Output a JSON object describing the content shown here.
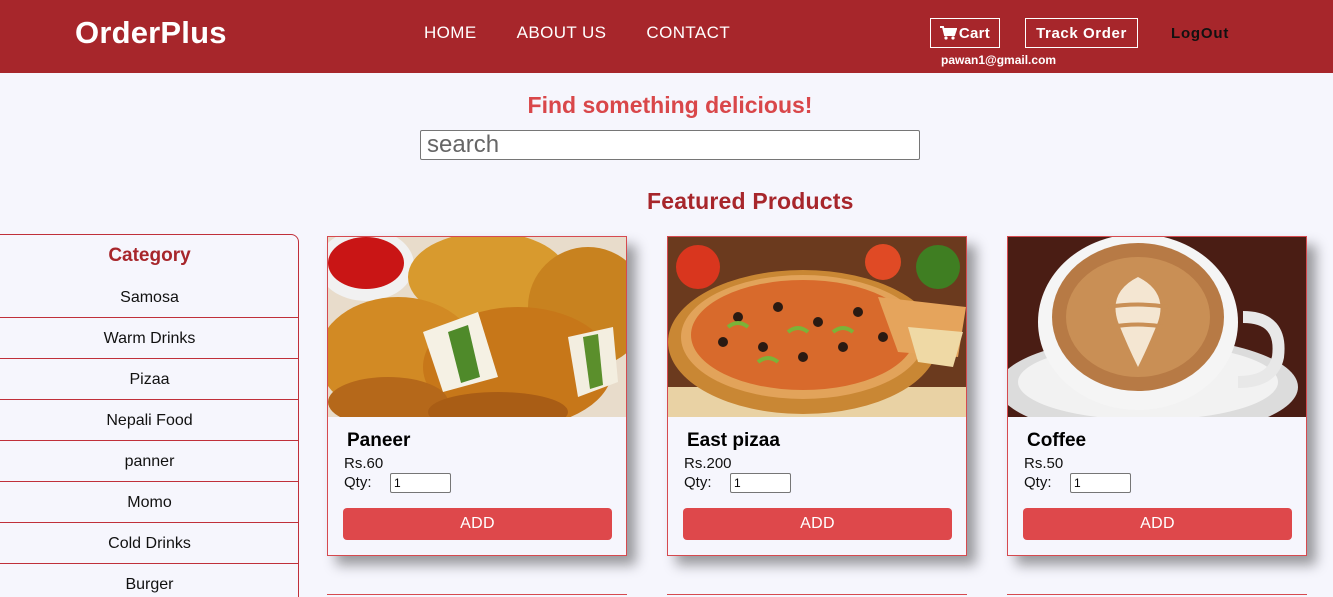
{
  "header": {
    "brand": "OrderPlus",
    "nav": [
      "HOME",
      "ABOUT US",
      "CONTACT"
    ],
    "cart_label": "Cart",
    "track_label": "Track Order",
    "logout_label": "LogOut",
    "user_email": "pawan1@gmail.com",
    "bar_color": "#a7262b"
  },
  "search": {
    "headline": "Find something delicious!",
    "placeholder": "search"
  },
  "featured_title": "Featured Products",
  "sidebar": {
    "title": "Category",
    "items": [
      "Samosa",
      "Warm Drinks",
      "Pizaa",
      "Nepali Food",
      "panner",
      "Momo",
      "Cold Drinks",
      "Burger"
    ]
  },
  "products": [
    {
      "name": "Paneer",
      "price": "Rs.60",
      "qty_label": "Qty:",
      "qty_value": "1",
      "add_label": "ADD",
      "image": "paneer-pakora-photo"
    },
    {
      "name": "East pizaa",
      "price": "Rs.200",
      "qty_label": "Qty:",
      "qty_value": "1",
      "add_label": "ADD",
      "image": "pizza-photo"
    },
    {
      "name": "Coffee",
      "price": "Rs.50",
      "qty_label": "Qty:",
      "qty_value": "1",
      "add_label": "ADD",
      "image": "coffee-latte-photo"
    }
  ],
  "colors": {
    "accent": "#de484b",
    "headline": "#d9474a",
    "background": "#f6f6fd"
  }
}
